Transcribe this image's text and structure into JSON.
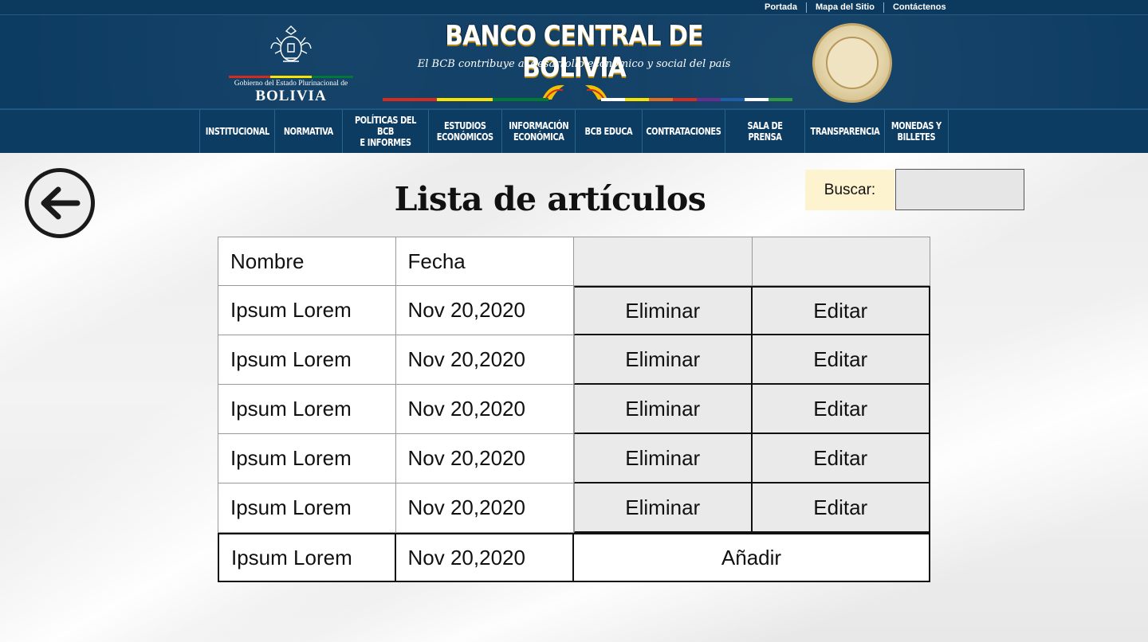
{
  "top_links": [
    "Portada",
    "Mapa del Sitio",
    "Contáctenos"
  ],
  "header": {
    "gov_logo_text": "Gobierno del Estado Plurinacional de",
    "gov_logo_country": "BOLIVIA",
    "bank_title": "BANCO CENTRAL DE BOLIVIA",
    "bank_motto": "El BCB contribuye al desarrollo económico y social del país"
  },
  "nav": [
    {
      "label": "INSTITUCIONAL"
    },
    {
      "label": "NORMATIVA"
    },
    {
      "label": "POLÍTICAS DEL BCB\nE INFORMES"
    },
    {
      "label": "ESTUDIOS\nECONÓMICOS"
    },
    {
      "label": "INFORMACIÓN\nECONÓMICA"
    },
    {
      "label": "BCB EDUCA"
    },
    {
      "label": "CONTRATACIONES"
    },
    {
      "label": "SALA DE PRENSA"
    },
    {
      "label": "TRANSPARENCIA"
    },
    {
      "label": "MONEDAS Y\nBILLETES"
    }
  ],
  "page_title": "Lista de artículos",
  "search": {
    "label": "Buscar:",
    "value": ""
  },
  "table": {
    "headers": [
      "Nombre",
      "Fecha",
      "",
      ""
    ],
    "rows": [
      {
        "name": "Ipsum Lorem",
        "date": "Nov 20,2020",
        "delete": "Eliminar",
        "edit": "Editar"
      },
      {
        "name": "Ipsum Lorem",
        "date": "Nov 20,2020",
        "delete": "Eliminar",
        "edit": "Editar"
      },
      {
        "name": "Ipsum Lorem",
        "date": "Nov 20,2020",
        "delete": "Eliminar",
        "edit": "Editar"
      },
      {
        "name": "Ipsum Lorem",
        "date": "Nov 20,2020",
        "delete": "Eliminar",
        "edit": "Editar"
      },
      {
        "name": "Ipsum Lorem",
        "date": "Nov 20,2020",
        "delete": "Eliminar",
        "edit": "Editar"
      }
    ],
    "add_row": {
      "name": "Ipsum Lorem",
      "date": "Nov 20,2020",
      "add": "Añadir"
    }
  },
  "colors": {
    "header_bg": "#0d3c63",
    "search_label_bg": "#fdf3cf",
    "flag": [
      "#d52b1e",
      "#f9e300",
      "#007934"
    ]
  },
  "icons": {
    "back": "arrow-left-circle-icon",
    "gov_logo": "coat-of-arms-icon",
    "seal": "bcb-seal-icon"
  }
}
